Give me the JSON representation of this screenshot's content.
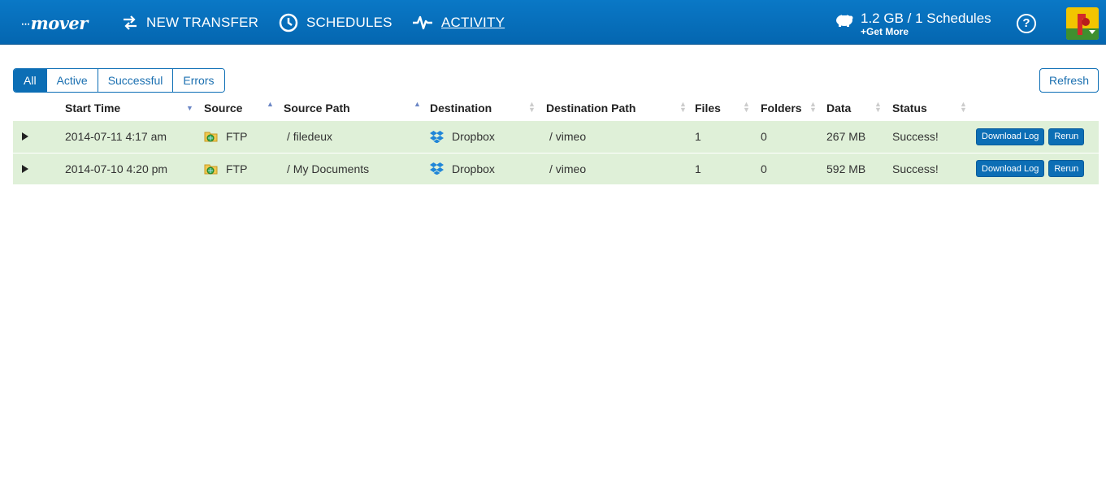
{
  "app": {
    "logo": "mover"
  },
  "nav": [
    {
      "label": "NEW TRANSFER",
      "icon": "transfer-arrows-icon"
    },
    {
      "label": "SCHEDULES",
      "icon": "clock-icon"
    },
    {
      "label": "ACTIVITY",
      "icon": "activity-pulse-icon",
      "active": true
    }
  ],
  "usage": {
    "main": "1.2 GB / 1 Schedules",
    "more": "+Get More"
  },
  "help": "?",
  "filters": {
    "all": "All",
    "active": "Active",
    "successful": "Successful",
    "errors": "Errors",
    "selected": "All"
  },
  "refresh_label": "Refresh",
  "table": {
    "headers": {
      "start_time": "Start Time",
      "source": "Source",
      "source_path": "Source Path",
      "destination": "Destination",
      "destination_path": "Destination Path",
      "files": "Files",
      "folders": "Folders",
      "data": "Data",
      "status": "Status"
    },
    "rows": [
      {
        "start_time": "2014-07-11 4:17 am",
        "source": "FTP",
        "source_path": "/ filedeux",
        "destination": "Dropbox",
        "destination_path": "/ vimeo",
        "files": "1",
        "folders": "0",
        "data": "267 MB",
        "status": "Success!",
        "download_label": "Download Log",
        "rerun_label": "Rerun"
      },
      {
        "start_time": "2014-07-10 4:20 pm",
        "source": "FTP",
        "source_path": "/ My Documents",
        "destination": "Dropbox",
        "destination_path": "/ vimeo",
        "files": "1",
        "folders": "0",
        "data": "592 MB",
        "status": "Success!",
        "download_label": "Download Log",
        "rerun_label": "Rerun"
      }
    ]
  },
  "colors": {
    "header_bg": "#0a74c2",
    "accent": "#0c6eb5",
    "success_row": "#dff0d8"
  }
}
